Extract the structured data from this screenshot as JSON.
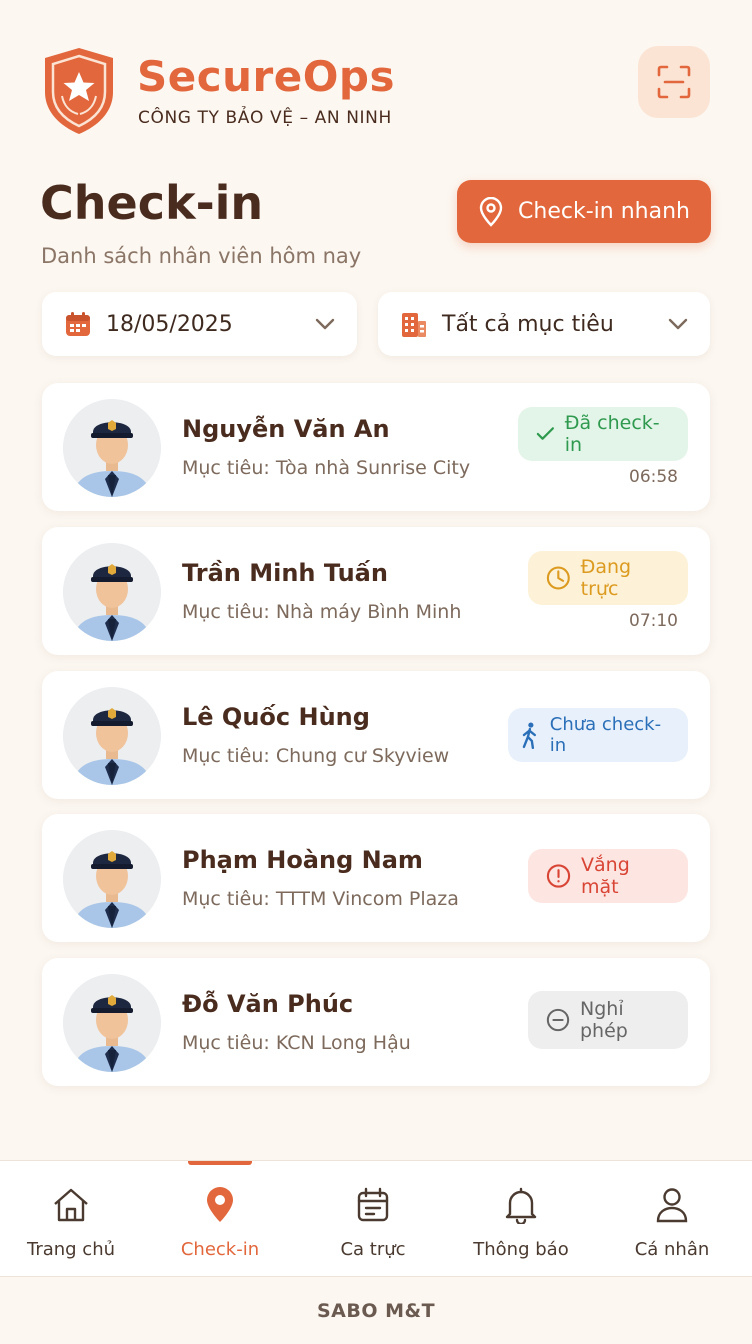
{
  "header": {
    "brand_name": "SecureOps",
    "brand_subtitle": "CÔNG TY BẢO VỆ – AN NINH",
    "scan_icon": "scan-icon"
  },
  "page": {
    "title": "Check-in",
    "subtitle": "Danh sách nhân viên hôm nay",
    "quick_checkin_label": "Check-in nhanh"
  },
  "filters": {
    "date": "18/05/2025",
    "target": "Tất cả mục tiêu"
  },
  "employees": [
    {
      "name": "Nguyễn Văn An",
      "target": "Mục tiêu: Tòa nhà Sunrise City",
      "status": "Đã check-in",
      "status_type": "checked-in",
      "time": "06:58"
    },
    {
      "name": "Trần Minh Tuấn",
      "target": "Mục tiêu: Nhà máy Bình Minh",
      "status": "Đang trực",
      "status_type": "on-duty",
      "time": "07:10"
    },
    {
      "name": "Lê Quốc Hùng",
      "target": "Mục tiêu: Chung cư Skyview",
      "status": "Chưa check-in",
      "status_type": "not-checked-in",
      "time": ""
    },
    {
      "name": "Phạm Hoàng Nam",
      "target": "Mục tiêu: TTTM Vincom Plaza",
      "status": "Vắng mặt",
      "status_type": "absent",
      "time": ""
    },
    {
      "name": "Đỗ Văn Phúc",
      "target": "Mục tiêu: KCN Long Hậu",
      "status": "Nghỉ phép",
      "status_type": "on-leave",
      "time": ""
    }
  ],
  "nav": [
    {
      "label": "Trang chủ",
      "icon": "home-icon"
    },
    {
      "label": "Check-in",
      "icon": "location-pin-icon",
      "active": true
    },
    {
      "label": "Ca trực",
      "icon": "calendar-icon"
    },
    {
      "label": "Thông báo",
      "icon": "bell-icon"
    },
    {
      "label": "Cá nhân",
      "icon": "user-icon"
    }
  ],
  "footer": "SABO M&T",
  "colors": {
    "accent": "#e2673c",
    "background": "#fcf7f1",
    "text": "#4a2c1f",
    "status_checked_in": "#2f9a4f",
    "status_on_duty": "#dc9a1f",
    "status_not_checked_in": "#2a6fb8",
    "status_absent": "#d94535",
    "status_on_leave": "#666666"
  }
}
